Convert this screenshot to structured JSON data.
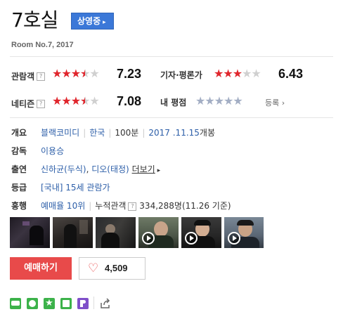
{
  "movie": {
    "title": "7호실",
    "status_badge": "상영중",
    "subtitle": "Room No.7, 2017"
  },
  "ratings": {
    "audience": {
      "label": "관람객",
      "score": "7.23",
      "stars": 3.5
    },
    "critics": {
      "label": "기자·평론가",
      "score": "6.43",
      "stars": 3
    },
    "netizen": {
      "label": "네티즌",
      "score": "7.08",
      "stars": 3.5
    },
    "my": {
      "label": "내 평점",
      "register": "등록"
    }
  },
  "info": {
    "overview": {
      "label": "개요",
      "genre": "블랙코미디",
      "country": "한국",
      "runtime": "100분",
      "release_date": "2017 .11.15",
      "release_suffix": "개봉"
    },
    "director": {
      "label": "감독",
      "name": "이용승"
    },
    "cast": {
      "label": "출연",
      "actor1": "신하균(두식)",
      "actor2": "디오(태정)",
      "more": "더보기"
    },
    "rating": {
      "label": "등급",
      "prefix": "[국내]",
      "grade": "15세 관람가"
    },
    "boxoffice": {
      "label": "흥행",
      "rank": "예매율 10위",
      "cumulative_label": "누적관객",
      "cumulative_value": "334,288명(11.26 기준)"
    }
  },
  "buttons": {
    "buy": "예매하기",
    "like_count": "4,509"
  },
  "icons": {
    "share": [
      "blog-icon",
      "band-icon",
      "star-share-icon",
      "line-icon",
      "kakao-icon",
      "share-out-icon"
    ]
  },
  "colors": {
    "accent_red": "#e84a4a",
    "star_red": "#e0252c",
    "badge_blue": "#3b78d8",
    "link_blue": "#2c5ea8"
  }
}
